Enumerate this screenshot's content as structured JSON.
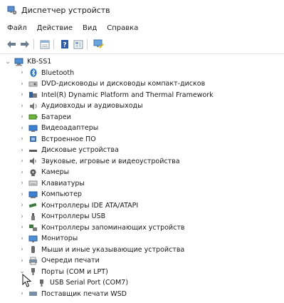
{
  "window": {
    "title": "Диспетчер устройств"
  },
  "menu": [
    "Файл",
    "Действие",
    "Вид",
    "Справка"
  ],
  "toolbar": [
    "back",
    "forward",
    "properties",
    "help",
    "view",
    "monitor"
  ],
  "tree": {
    "root": "KB-SS1",
    "categories": [
      {
        "label": "Bluetooth",
        "icon": "bluetooth-icon"
      },
      {
        "label": "DVD-дисководы и дисководы компакт-дисков",
        "icon": "dvd-drive-icon"
      },
      {
        "label": "Intel(R) Dynamic Platform and Thermal Framework",
        "icon": "intel-framework-icon"
      },
      {
        "label": "Аудиовходы и аудиовыходы",
        "icon": "audio-io-icon"
      },
      {
        "label": "Батареи",
        "icon": "battery-icon"
      },
      {
        "label": "Видеоадаптеры",
        "icon": "display-adapter-icon"
      },
      {
        "label": "Встроенное ПО",
        "icon": "firmware-icon"
      },
      {
        "label": "Дисковые устройства",
        "icon": "disk-drive-icon"
      },
      {
        "label": "Звуковые, игровые и видеоустройства",
        "icon": "sound-icon"
      },
      {
        "label": "Камеры",
        "icon": "camera-icon"
      },
      {
        "label": "Клавиатуры",
        "icon": "keyboard-icon"
      },
      {
        "label": "Компьютер",
        "icon": "computer-icon"
      },
      {
        "label": "Контроллеры IDE ATA/ATAPI",
        "icon": "ide-controller-icon"
      },
      {
        "label": "Контроллеры USB",
        "icon": "usb-icon"
      },
      {
        "label": "Контроллеры запоминающих устройств",
        "icon": "storage-controller-icon"
      },
      {
        "label": "Мониторы",
        "icon": "monitor-icon"
      },
      {
        "label": "Мыши и иные указывающие устройства",
        "icon": "mouse-icon"
      },
      {
        "label": "Очереди печати",
        "icon": "print-queue-icon"
      },
      {
        "label": "Порты (COM и LPT)",
        "icon": "port-icon",
        "expanded": true,
        "children": [
          {
            "label": "USB Serial Port (COM7)",
            "icon": "port-device-icon"
          }
        ]
      },
      {
        "label": "Поставщик печати WSD",
        "icon": "wsd-print-icon"
      }
    ]
  },
  "colors": {
    "accent": "#1e70c8",
    "text": "#1a1a1a"
  }
}
